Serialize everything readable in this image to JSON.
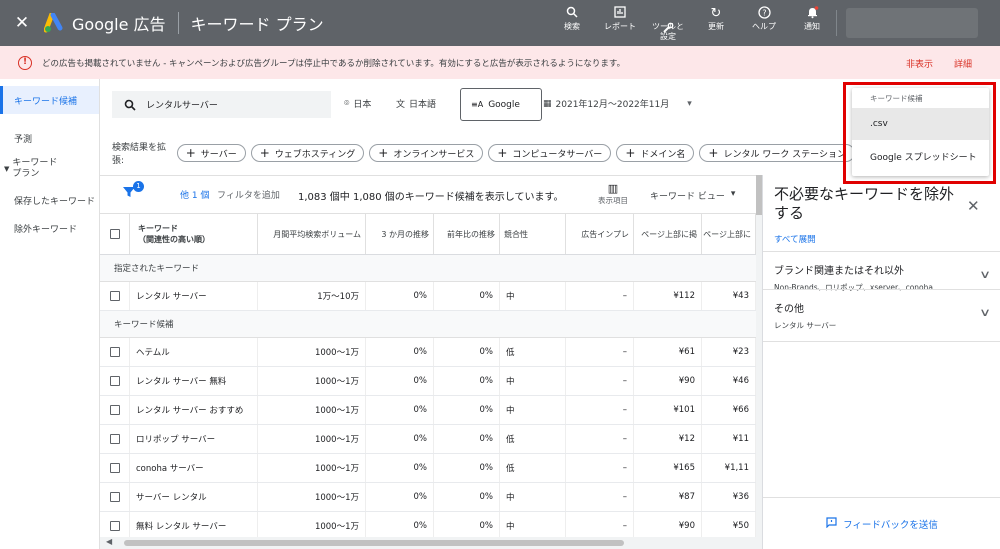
{
  "topbar": {
    "close": "✕",
    "brand": "Google 広告",
    "page_title": "キーワード プラン",
    "tools": [
      {
        "icon": "search-icon",
        "glyph": "⌕",
        "label": "検索"
      },
      {
        "icon": "report-icon",
        "glyph": "▥",
        "label": "レポート"
      },
      {
        "icon": "wrench-icon",
        "glyph": "🔧",
        "label": "ツールと\n設定"
      },
      {
        "icon": "refresh-icon",
        "glyph": "↻",
        "label": "更新"
      },
      {
        "icon": "help-icon",
        "glyph": "?",
        "label": "ヘルプ"
      },
      {
        "icon": "bell-icon",
        "glyph": "🔔",
        "label": "通知"
      }
    ]
  },
  "alert": {
    "icon": "!",
    "message": "どの広告も掲載されていません - キャンペーンおよび広告グループは停止中であるか削除されています。有効にすると広告が表示されるようになります。",
    "hide": "非表示",
    "details": "詳細"
  },
  "nav": {
    "items": [
      "キーワード候補",
      "予測",
      "キーワード\nプラン",
      "保存したキーワード",
      "除外キーワード"
    ]
  },
  "filters": {
    "search_value": "レンタルサーバー",
    "location": "日本",
    "language": "日本語",
    "engine": "Google",
    "date_range": "2021年12月〜2022年11月"
  },
  "expand": {
    "label": "検索結果を拡張:",
    "chips": [
      "サーバー",
      "ウェブホスティング",
      "オンラインサービス",
      "コンピュータサーバー",
      "ドメイン名",
      "レンタル ワーク ステーション"
    ]
  },
  "tabletools": {
    "filter_count": "1",
    "more_filters": "他 1 個",
    "add_filter": "フィルタを追加",
    "summary": "1,083 個中 1,080 個のキーワード候補を表示しています。",
    "columns_label": "表示項目",
    "view": "キーワード ビュー"
  },
  "table": {
    "headers": [
      "キーワード\n（関連性の高い順）",
      "月間平均検索ボリューム",
      "3 か月の推移",
      "前年比の推移",
      "競合性",
      "広告インプレ",
      "ページ上部に掲",
      "ページ上部に"
    ],
    "section_specified": "指定されたキーワード",
    "section_ideas": "キーワード候補",
    "specified_rows": [
      {
        "kw": "レンタル サーバー",
        "vol": "1万〜10万",
        "m3": "0%",
        "yoy": "0%",
        "comp": "中",
        "imp": "–",
        "low": "¥112",
        "high": "¥43"
      }
    ],
    "idea_rows": [
      {
        "kw": "ヘテムル",
        "vol": "1000〜1万",
        "m3": "0%",
        "yoy": "0%",
        "comp": "低",
        "imp": "–",
        "low": "¥61",
        "high": "¥23"
      },
      {
        "kw": "レンタル サーバー 無料",
        "vol": "1000〜1万",
        "m3": "0%",
        "yoy": "0%",
        "comp": "中",
        "imp": "–",
        "low": "¥90",
        "high": "¥46"
      },
      {
        "kw": "レンタル サーバー おすすめ",
        "vol": "1000〜1万",
        "m3": "0%",
        "yoy": "0%",
        "comp": "中",
        "imp": "–",
        "low": "¥101",
        "high": "¥66"
      },
      {
        "kw": "ロリポップ サーバー",
        "vol": "1000〜1万",
        "m3": "0%",
        "yoy": "0%",
        "comp": "低",
        "imp": "–",
        "low": "¥12",
        "high": "¥11"
      },
      {
        "kw": "conoha サーバー",
        "vol": "1000〜1万",
        "m3": "0%",
        "yoy": "0%",
        "comp": "低",
        "imp": "–",
        "low": "¥165",
        "high": "¥1,11"
      },
      {
        "kw": "サーバー レンタル",
        "vol": "1000〜1万",
        "m3": "0%",
        "yoy": "0%",
        "comp": "中",
        "imp": "–",
        "low": "¥87",
        "high": "¥36"
      },
      {
        "kw": "無料 レンタル サーバー",
        "vol": "1000〜1万",
        "m3": "0%",
        "yoy": "0%",
        "comp": "中",
        "imp": "–",
        "low": "¥90",
        "high": "¥50"
      }
    ]
  },
  "rpanel": {
    "title": "不必要なキーワードを除外する",
    "close": "✕",
    "expand_all": "すべて展開",
    "groups": [
      {
        "title": "ブランド関連またはそれ以外",
        "sub": "Non-Brands、ロリポップ、xserver、conoha..."
      },
      {
        "title": "その他",
        "sub": "レンタル サーバー"
      }
    ],
    "feedback": "フィードバックを送信"
  },
  "download_menu": {
    "header": "キーワード候補",
    "items": [
      ".csv",
      "Google スプレッドシート"
    ]
  },
  "colors": {
    "topbar": "#5f6368",
    "accent": "#1a73e8",
    "alert_bg": "#fde7e9",
    "alert_red": "#d93025",
    "highlight": "#e00000"
  }
}
